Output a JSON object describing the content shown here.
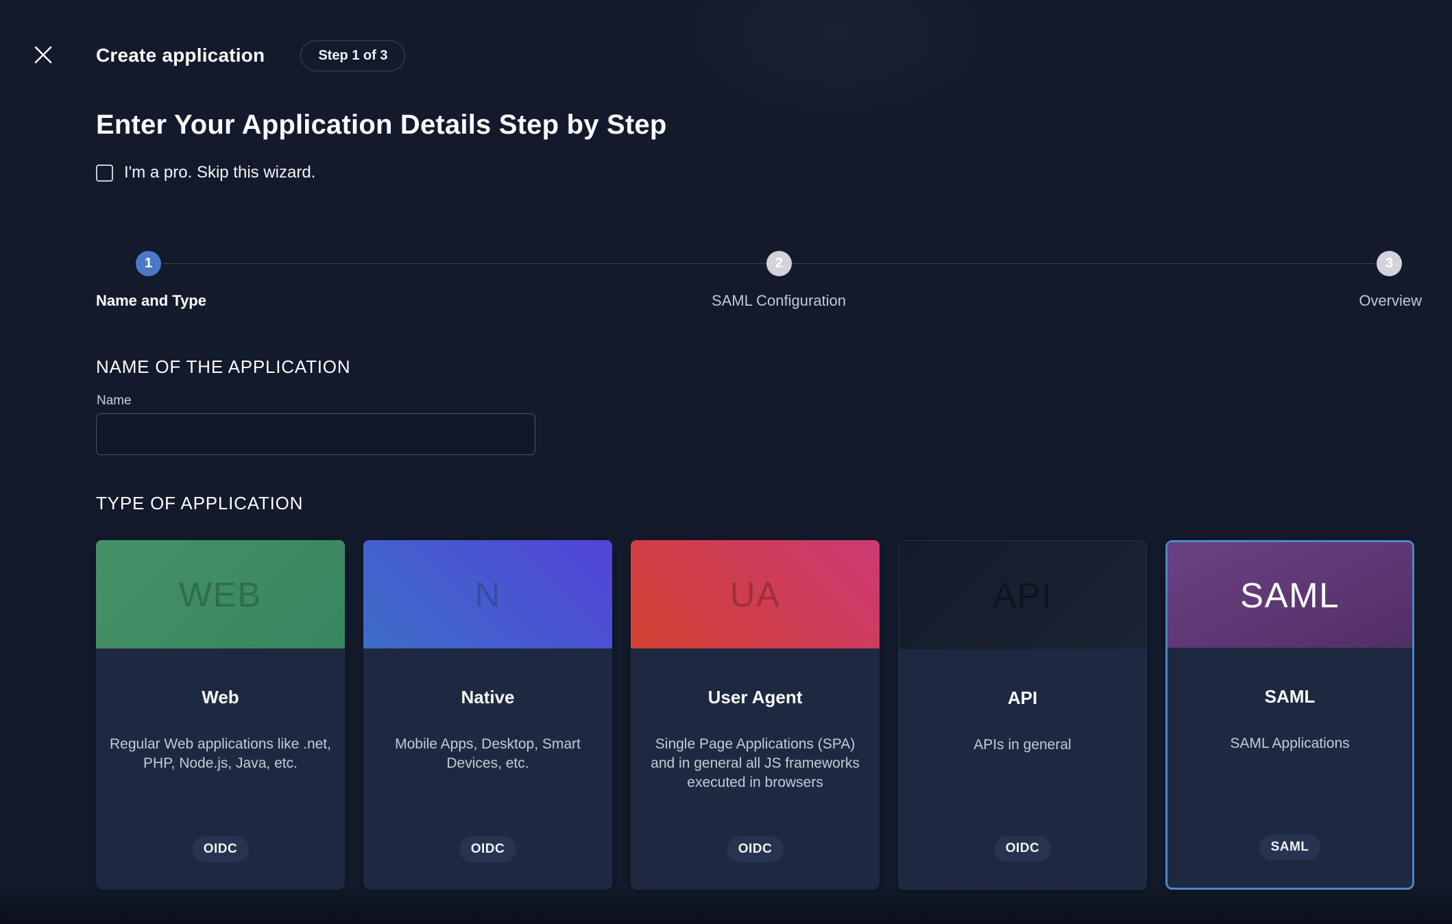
{
  "theme": {
    "background": "#121a2b",
    "card_body": "#1e2941",
    "active_step_blue": "#4b79c5",
    "inactive_step_gray": "#d2d4d9",
    "selected_card_border": "#4d87c8",
    "badge_background": "#273450"
  },
  "header": {
    "title": "Create application",
    "step_badge": "Step 1 of 3"
  },
  "intro": {
    "heading": "Enter Your Application Details Step by Step",
    "skip_label": "I'm a pro. Skip this wizard.",
    "skip_checked": false
  },
  "stepper": {
    "steps": [
      {
        "number": "1",
        "label": "Name and Type",
        "state": "active"
      },
      {
        "number": "2",
        "label": "SAML Configuration",
        "state": "upcoming"
      },
      {
        "number": "3",
        "label": "Overview",
        "state": "upcoming"
      }
    ]
  },
  "form": {
    "name_section_title": "NAME OF THE APPLICATION",
    "name_label": "Name",
    "name_value": "",
    "type_section_title": "TYPE OF APPLICATION"
  },
  "app_types": [
    {
      "header_text": "WEB",
      "header_text_color": "#2e6e4e",
      "gradient_angle": "135deg",
      "gradient_from": "#479066",
      "gradient_to": "#378660",
      "title": "Web",
      "description": "Regular Web applications like .net, PHP, Node.js, Java, etc.",
      "badge": "OIDC",
      "selected": false
    },
    {
      "header_text": "N",
      "header_text_color": "#30509f",
      "gradient_angle": "45deg",
      "gradient_from": "#3d6ec8",
      "gradient_to": "#5243d8",
      "title": "Native",
      "description": "Mobile Apps, Desktop, Smart Devices, etc.",
      "badge": "OIDC",
      "selected": false
    },
    {
      "header_text": "UA",
      "header_text_color": "#a03038",
      "gradient_angle": "45deg",
      "gradient_from": "#d2402f",
      "gradient_to": "#cb3a74",
      "title": "User Agent",
      "description": "Single Page Applications (SPA) and in general all JS frameworks executed in browsers",
      "badge": "OIDC",
      "selected": false
    },
    {
      "header_text": "API",
      "header_text_color": "#0d141f",
      "gradient_angle": "135deg",
      "gradient_from": "#141c2c",
      "gradient_to": "#1b2434",
      "title": "API",
      "description": "APIs in general",
      "badge": "OIDC",
      "selected": false
    },
    {
      "header_text": "SAML",
      "header_text_color": "#ffffff",
      "gradient_angle": "155deg",
      "gradient_from": "#6c4182",
      "gradient_to": "#512f66",
      "title": "SAML",
      "description": "SAML Applications",
      "badge": "SAML",
      "selected": true
    }
  ]
}
